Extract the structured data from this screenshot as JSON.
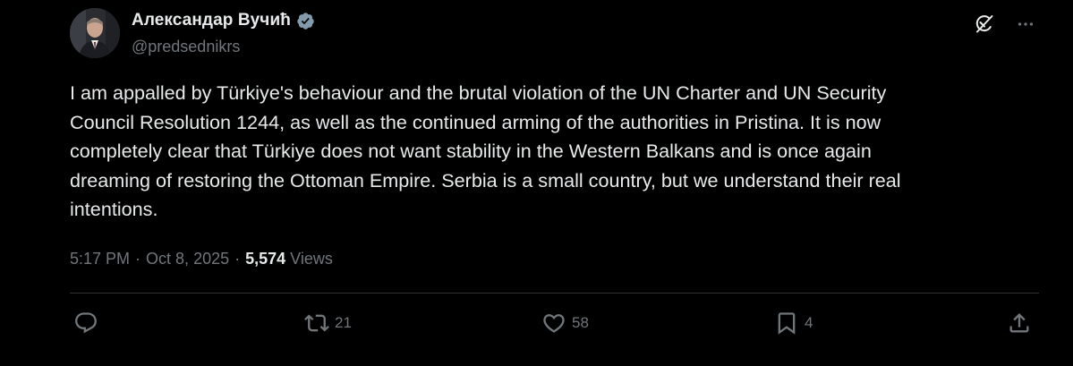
{
  "author": {
    "display_name": "Александар Вучић",
    "handle": "@predsednikrs",
    "verified": true
  },
  "post": {
    "text": "I am appalled by Türkiye's behaviour and the brutal violation of the UN Charter and UN Security\nCouncil Resolution 1244, as well as the continued arming of the authorities in Pristina. It is now\ncompletely clear that Türkiye does not want stability in the Western Balkans and is once again\ndreaming of restoring the Ottoman Empire. Serbia is a small country, but we understand their real\nintentions.",
    "time": "5:17 PM",
    "date": "Oct 8, 2025",
    "views_count": "5,574",
    "views_label": "Views",
    "separator": "·"
  },
  "actions": {
    "reply_count": "",
    "repost_count": "21",
    "like_count": "58",
    "bookmark_count": "4"
  },
  "icons": {
    "top": [
      "grok-icon",
      "more-icon"
    ],
    "actions": [
      "reply-icon",
      "repost-icon",
      "like-icon",
      "bookmark-icon",
      "share-icon"
    ]
  },
  "colors": {
    "background": "#000000",
    "primary_text": "#e7e9ea",
    "secondary_text": "#71767b",
    "verified_badge": "#829aab",
    "divider": "#2f3336"
  }
}
